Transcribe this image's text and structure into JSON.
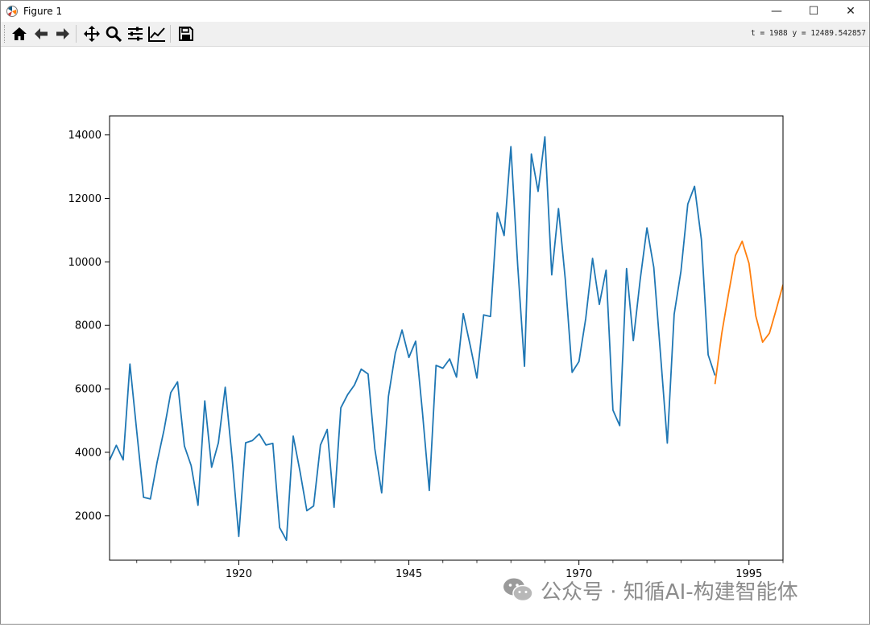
{
  "window": {
    "title": "Figure 1",
    "icon": "matplotlib-icon"
  },
  "window_controls": {
    "minimize": "—",
    "maximize": "☐",
    "close": "✕"
  },
  "toolbar": {
    "buttons": [
      "home-icon",
      "back-icon",
      "forward-icon",
      "pan-icon",
      "zoom-icon",
      "configure-subplots-icon",
      "edit-axes-icon",
      "save-icon"
    ]
  },
  "status": {
    "coords": "t = 1988  y = 12489.542857"
  },
  "watermark": {
    "text": "公众号 · 知循AI-构建智能体"
  },
  "colors": {
    "history": "#1f77b4",
    "forecast": "#ff7f0e"
  },
  "chart_data": {
    "type": "line",
    "title": "",
    "xlabel": "",
    "ylabel": "",
    "xlim": [
      1901,
      2000
    ],
    "ylim": [
      600,
      14600
    ],
    "xticks": [
      1920,
      1945,
      1970,
      1995
    ],
    "yticks": [
      2000,
      4000,
      6000,
      8000,
      10000,
      12000,
      14000
    ],
    "grid": false,
    "series": [
      {
        "x": [
          1901,
          1902,
          1903,
          1904,
          1905,
          1906,
          1907,
          1908,
          1909,
          1910,
          1911,
          1912,
          1913,
          1914,
          1915,
          1916,
          1917,
          1918,
          1919,
          1920,
          1921,
          1922,
          1923,
          1924,
          1925,
          1926,
          1927,
          1928,
          1929,
          1930,
          1931,
          1932,
          1933,
          1934,
          1935,
          1936,
          1937,
          1938,
          1939,
          1940,
          1941,
          1942,
          1943,
          1944,
          1945,
          1946,
          1947,
          1948,
          1949,
          1950,
          1951,
          1952,
          1953,
          1954,
          1955,
          1956,
          1957,
          1958,
          1959,
          1960,
          1961,
          1962,
          1963,
          1964,
          1965,
          1966,
          1967,
          1968,
          1969,
          1970,
          1971,
          1972,
          1973,
          1974,
          1975,
          1976,
          1977,
          1978,
          1979,
          1980,
          1981,
          1982,
          1983,
          1984,
          1985,
          1986,
          1987,
          1988,
          1989,
          1990
        ],
        "values": [
          3750,
          4220,
          3760,
          6780,
          4650,
          2580,
          2530,
          3700,
          4700,
          5880,
          6220,
          4200,
          3580,
          2330,
          5620,
          3530,
          4300,
          6050,
          3850,
          1350,
          4300,
          4370,
          4580,
          4230,
          4280,
          1630,
          1230,
          4510,
          3400,
          2160,
          2310,
          4230,
          4720,
          2270,
          5400,
          5820,
          6120,
          6620,
          6470,
          4110,
          2720,
          5760,
          7120,
          7850,
          6990,
          7500,
          5270,
          2800,
          6740,
          6650,
          6940,
          6370,
          8370,
          7380,
          6340,
          8330,
          8280,
          11550,
          10830,
          13630,
          9870,
          6710,
          13400,
          12220,
          13940,
          9590,
          11680,
          9430,
          6520,
          6860,
          8210,
          10110,
          8660,
          9740,
          5330,
          4840,
          9790,
          7520,
          9440,
          11070,
          9830,
          7070,
          4290,
          8350,
          9700,
          11820,
          12380,
          10700,
          7070,
          6420
        ]
      },
      {
        "x": [
          1990,
          1991,
          1992,
          1993,
          1994,
          1995,
          1996,
          1997,
          1998,
          1999,
          2000
        ],
        "values": [
          6150,
          7750,
          9000,
          10200,
          10650,
          9950,
          8300,
          7470,
          7750,
          8500,
          9280
        ]
      }
    ]
  }
}
